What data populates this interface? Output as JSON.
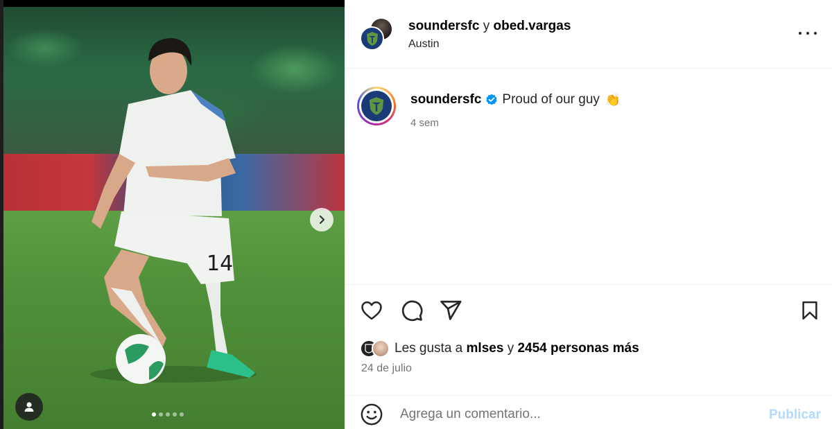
{
  "post": {
    "author": "soundersfc",
    "conjunction": "y",
    "collaborator": "obed.vargas",
    "location": "Austin",
    "caption_text": "Proud of our guy",
    "caption_emoji": "👏",
    "time_ago": "4 sem",
    "date": "24 de julio",
    "carousel_total": 5,
    "carousel_active": 1
  },
  "likes": {
    "prefix": "Les gusta a",
    "first_user": "mlses",
    "connector": "y",
    "others": "2454 personas más"
  },
  "comment": {
    "placeholder": "Agrega un comentario...",
    "publish_label": "Publicar"
  },
  "colors": {
    "verified": "#0095f6",
    "publish_disabled": "#b3dbff",
    "crest_blue": "#1a3a78",
    "crest_green": "#5d9741"
  },
  "icons": [
    "chevron-right-icon",
    "user-tag-icon",
    "more-options-icon",
    "verified-badge-icon",
    "heart-icon",
    "comment-icon",
    "share-icon",
    "bookmark-icon",
    "emoji-icon"
  ]
}
